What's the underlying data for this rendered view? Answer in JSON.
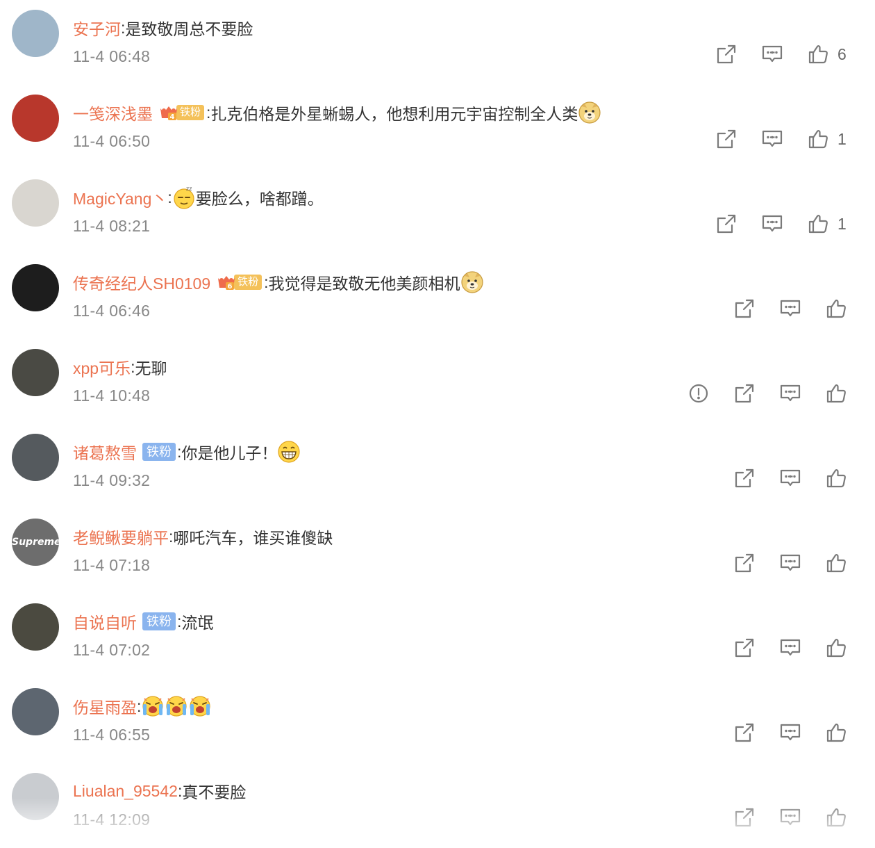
{
  "comments": [
    {
      "username": "安子河",
      "content": "是致敬周总不要脸",
      "time": "11-4 06:48",
      "likes": "6",
      "badge": null,
      "emojis": [],
      "report": false,
      "avatar_color": "#9fb6c9"
    },
    {
      "username": "一笺深浅墨",
      "content": "扎克伯格是外星蜥蜴人，他想利用元宇宙控制全人类",
      "time": "11-4 06:50",
      "likes": "1",
      "badge": {
        "type": "gold",
        "level": "4",
        "label": "铁粉"
      },
      "emojis": [
        "doge"
      ],
      "report": false,
      "avatar_color": "#b8372c"
    },
    {
      "username": "MagicYang丶",
      "content": "要脸么，啥都蹭。",
      "time": "11-4 08:21",
      "likes": "1",
      "badge": null,
      "emojis_before": [
        "sleepy"
      ],
      "emojis": [],
      "report": false,
      "avatar_color": "#d9d6d0"
    },
    {
      "username": "传奇经纪人SH0109",
      "content": "我觉得是致敬无他美颜相机",
      "time": "11-4 06:46",
      "likes": "",
      "badge": {
        "type": "gold",
        "level": "6",
        "label": "铁粉"
      },
      "emojis": [
        "doge"
      ],
      "report": false,
      "avatar_color": "#1d1d1d"
    },
    {
      "username": "xpp可乐",
      "content": "无聊",
      "time": "11-4 10:48",
      "likes": "",
      "badge": null,
      "emojis": [],
      "report": true,
      "avatar_color": "#4a4a44"
    },
    {
      "username": "诸葛熬雪",
      "content": "你是他儿子！",
      "time": "11-4 09:32",
      "likes": "",
      "badge": {
        "type": "blue",
        "label": "铁粉"
      },
      "emojis": [
        "grin"
      ],
      "report": false,
      "avatar_color": "#555a5e"
    },
    {
      "username": "老鲵鳅要躺平",
      "content": "哪吒汽车，谁买谁傻缺",
      "time": "11-4 07:18",
      "likes": "",
      "badge": null,
      "emojis": [],
      "report": false,
      "avatar_color": "#6d6d6d",
      "avatar_text": "Supreme"
    },
    {
      "username": "自说自听",
      "content": "流氓",
      "time": "11-4 07:02",
      "likes": "",
      "badge": {
        "type": "blue",
        "label": "铁粉"
      },
      "emojis": [],
      "report": false,
      "avatar_color": "#4b4a40"
    },
    {
      "username": "伤星雨盈",
      "content": "",
      "time": "11-4 06:55",
      "likes": "",
      "badge": null,
      "emojis": [
        "cry",
        "cry",
        "cry"
      ],
      "report": false,
      "avatar_color": "#5d6670"
    },
    {
      "username": "Liualan_95542",
      "content": "真不要脸",
      "time": "11-4 12:09",
      "likes": "",
      "badge": null,
      "emojis": [],
      "report": false,
      "avatar_color": "#c9ccd0"
    }
  ],
  "icons": {
    "share": "share-icon",
    "comment": "comment-icon",
    "like": "thumbs-up-icon",
    "report": "report-icon"
  },
  "colors": {
    "username": "#eb7350",
    "time": "#888888",
    "icon": "#7a7a7a",
    "fan_gold": "#f4c15a",
    "fan_blue": "#8ab4ee"
  }
}
